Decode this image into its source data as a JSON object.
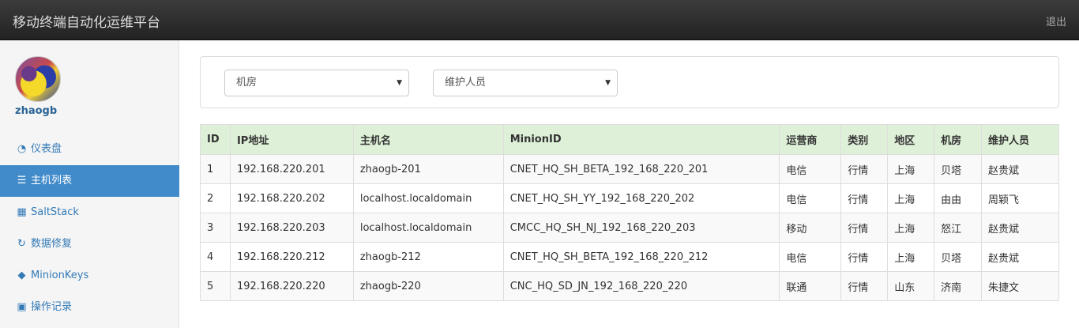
{
  "header": {
    "title": "移动终端自动化运维平台",
    "logout": "退出"
  },
  "sidebar": {
    "username": "zhaogb",
    "items": [
      {
        "label": "仪表盘",
        "icon": "dashboard-icon",
        "glyph": "◔"
      },
      {
        "label": "主机列表",
        "icon": "list-icon",
        "glyph": "☰"
      },
      {
        "label": "SaltStack",
        "icon": "grid-icon",
        "glyph": "▦"
      },
      {
        "label": "数据修复",
        "icon": "refresh-icon",
        "glyph": "↻"
      },
      {
        "label": "MinionKeys",
        "icon": "tags-icon",
        "glyph": "◆"
      },
      {
        "label": "操作记录",
        "icon": "save-icon",
        "glyph": "▣"
      }
    ],
    "active_index": 1
  },
  "filters": {
    "room_select": "机房",
    "maintainer_select": "维护人员"
  },
  "table": {
    "columns": [
      "ID",
      "IP地址",
      "主机名",
      "MinionID",
      "运营商",
      "类别",
      "地区",
      "机房",
      "维护人员"
    ],
    "rows": [
      [
        "1",
        "192.168.220.201",
        "zhaogb-201",
        "CNET_HQ_SH_BETA_192_168_220_201",
        "电信",
        "行情",
        "上海",
        "贝塔",
        "赵贵斌"
      ],
      [
        "2",
        "192.168.220.202",
        "localhost.localdomain",
        "CNET_HQ_SH_YY_192_168_220_202",
        "电信",
        "行情",
        "上海",
        "由由",
        "周颖飞"
      ],
      [
        "3",
        "192.168.220.203",
        "localhost.localdomain",
        "CMCC_HQ_SH_NJ_192_168_220_203",
        "移动",
        "行情",
        "上海",
        "怒江",
        "赵贵斌"
      ],
      [
        "4",
        "192.168.220.212",
        "zhaogb-212",
        "CNET_HQ_SH_BETA_192_168_220_212",
        "电信",
        "行情",
        "上海",
        "贝塔",
        "赵贵斌"
      ],
      [
        "5",
        "192.168.220.220",
        "zhaogb-220",
        "CNC_HQ_SD_JN_192_168_220_220",
        "联通",
        "行情",
        "山东",
        "济南",
        "朱捷文"
      ]
    ]
  }
}
